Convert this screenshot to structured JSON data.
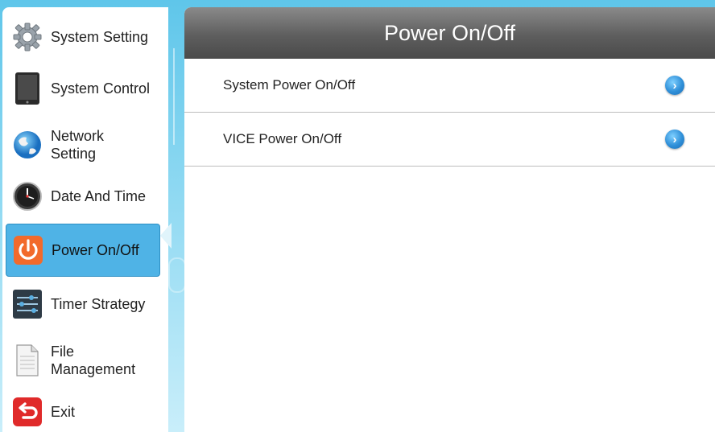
{
  "sidebar": {
    "items": [
      {
        "label": "System Setting",
        "icon": "gear-icon"
      },
      {
        "label": "System Control",
        "icon": "tablet-icon"
      },
      {
        "label": "Network Setting",
        "icon": "globe-icon"
      },
      {
        "label": "Date And Time",
        "icon": "clock-icon"
      },
      {
        "label": "Power On/Off",
        "icon": "power-icon",
        "active": true
      },
      {
        "label": "Timer Strategy",
        "icon": "sliders-icon"
      },
      {
        "label": "File Management",
        "icon": "document-icon"
      },
      {
        "label": "Exit",
        "icon": "exit-icon"
      }
    ]
  },
  "panel": {
    "title": "Power On/Off",
    "rows": [
      {
        "label": "System Power On/Off",
        "icon": "chevron-right-icon"
      },
      {
        "label": "VICE Power On/Off",
        "icon": "chevron-right-icon"
      }
    ]
  },
  "colors": {
    "active_bg": "#4fb3e6",
    "header_bg": "#5e5e5e",
    "arrow": "#2f8fd8",
    "power_icon": "#f26a2b",
    "exit_icon": "#e02a2a"
  }
}
